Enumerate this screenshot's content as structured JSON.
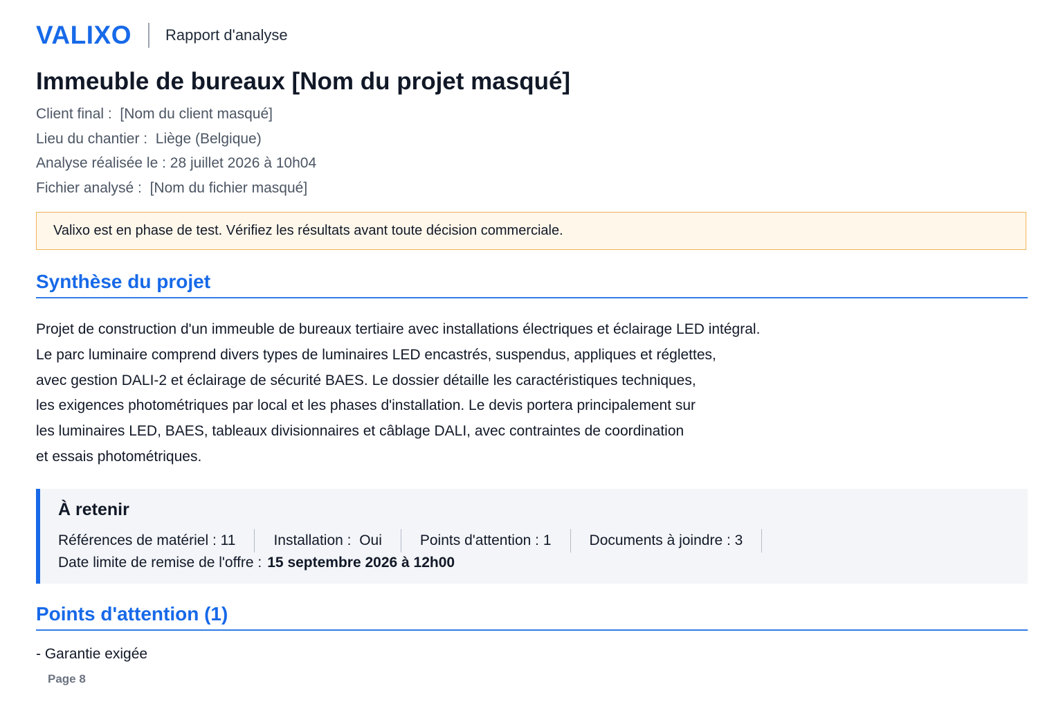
{
  "header": {
    "brand": "VALIXO",
    "subtitle": "Rapport d'analyse"
  },
  "project": {
    "title": "Immeuble de bureaux [Nom du projet masqué]",
    "meta": [
      {
        "label": "Client final :",
        "value": "[Nom du client masqué]"
      },
      {
        "label": "Lieu du chantier :",
        "value": "Liège (Belgique)"
      },
      {
        "label": "Analyse réalisée le :",
        "value": "28 juillet 2026 à 10h04"
      },
      {
        "label": "Fichier analysé :",
        "value": "[Nom du fichier masqué]"
      }
    ]
  },
  "banner": {
    "text": "Valixo est en phase de test. Vérifiez les résultats avant toute décision commerciale.",
    "border_color": "#f0b35a",
    "background_color": "#fff7ea"
  },
  "synthese": {
    "heading": "Synthèse du projet",
    "lines": [
      "Projet de construction d'un immeuble de bureaux tertiaire avec installations électriques et éclairage LED intégral.",
      "Le parc luminaire comprend divers types de luminaires LED encastrés, suspendus, appliques et réglettes,",
      "avec gestion DALI-2 et éclairage de sécurité BAES. Le dossier détaille les caractéristiques techniques,",
      "les exigences photométriques par local et les phases d'installation. Le devis portera principalement sur",
      "les luminaires LED, BAES, tableaux divisionnaires et câblage DALI, avec contraintes de coordination",
      "et essais photométriques."
    ]
  },
  "retenir": {
    "title": "À retenir",
    "stats": [
      {
        "label": "Références de matériel :",
        "value": "11"
      },
      {
        "label": "Installation :",
        "value": "Oui"
      },
      {
        "label": "Points d'attention :",
        "value": "1"
      },
      {
        "label": "Documents à joindre :",
        "value": "3"
      }
    ],
    "deadline_label": "Date limite de remise de l'offre :",
    "deadline_value": "15 septembre 2026 à 12h00"
  },
  "attention": {
    "heading": "Points d'attention (1)",
    "items": [
      "- Garantie exigée"
    ]
  },
  "footer": {
    "page": "Page 8"
  },
  "colors": {
    "accent": "#1769e8",
    "text": "#111827",
    "muted": "#4b5563"
  }
}
